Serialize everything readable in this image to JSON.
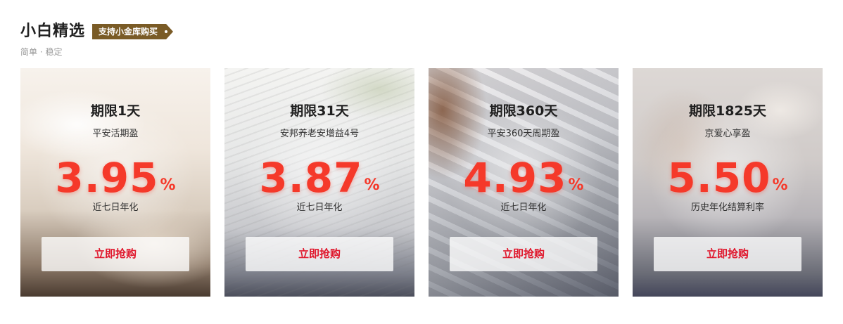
{
  "header": {
    "title": "小白精选",
    "tag": "支持小金库购买",
    "subtitle": "简单 · 稳定"
  },
  "cards": [
    {
      "period": "期限1天",
      "product": "平安活期盈",
      "rate": "3.95",
      "rate_unit": "%",
      "rate_label": "近七日年化",
      "button": "立即抢购"
    },
    {
      "period": "期限31天",
      "product": "安邦养老安增益4号",
      "rate": "3.87",
      "rate_unit": "%",
      "rate_label": "近七日年化",
      "button": "立即抢购"
    },
    {
      "period": "期限360天",
      "product": "平安360天周期盈",
      "rate": "4.93",
      "rate_unit": "%",
      "rate_label": "近七日年化",
      "button": "立即抢购"
    },
    {
      "period": "期限1825天",
      "product": "京爱心享盈",
      "rate": "5.50",
      "rate_unit": "%",
      "rate_label": "历史年化结算利率",
      "button": "立即抢购"
    }
  ],
  "colors": {
    "rate": "#f5392a",
    "button_text": "#e0182d",
    "tag_background": "#7a5b26"
  }
}
